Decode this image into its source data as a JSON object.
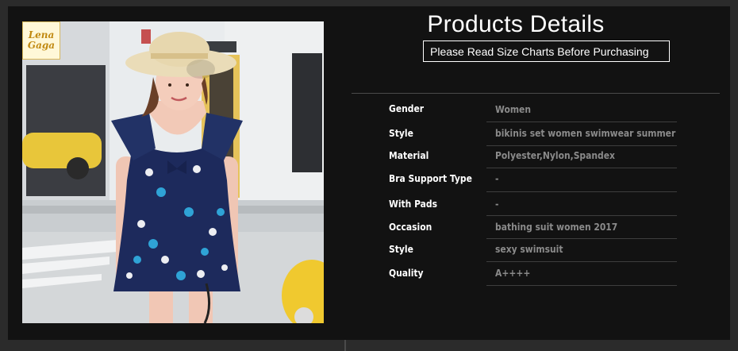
{
  "brand": {
    "logo_line1": "Lena",
    "logo_line2": "Gaga"
  },
  "header": {
    "title": "Products Details",
    "notice": "Please Read Size Charts Before Purchasing"
  },
  "specs": [
    {
      "label": "Gender",
      "value": "Women"
    },
    {
      "label": "Style",
      "value": "bikinis set women swimwear summer"
    },
    {
      "label": "Material",
      "value": "Polyester,Nylon,Spandex"
    },
    {
      "label": "Bra Support Type",
      "value": "-"
    },
    {
      "label": "With Pads",
      "value": "-"
    },
    {
      "label": "Occasion",
      "value": "bathing suit women 2017"
    },
    {
      "label": "Style",
      "value": "sexy swimsuit"
    },
    {
      "label": "Quality",
      "value": "A++++"
    }
  ],
  "colors": {
    "background": "#121212",
    "label": "#ffffff",
    "value": "#8a8a8a",
    "dress": "#1d2a5c"
  }
}
